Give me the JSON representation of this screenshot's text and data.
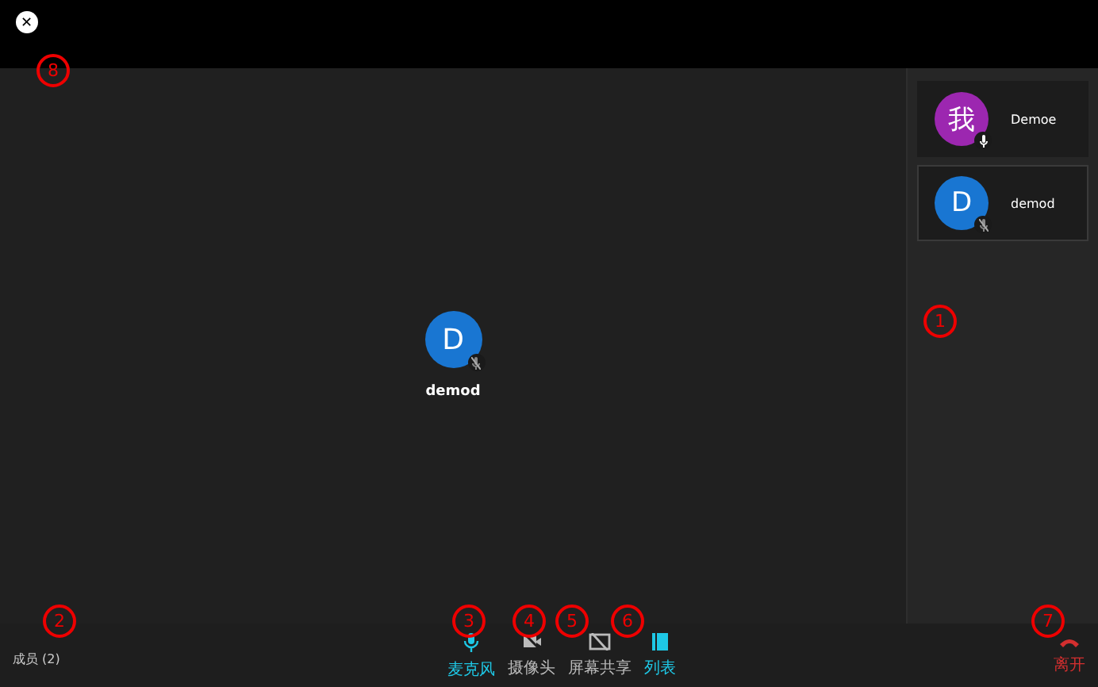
{
  "close_button": {
    "label": "✕"
  },
  "participants": [
    {
      "avatar": "我",
      "name": "Demoe",
      "color": "#9c27b0",
      "muted": false,
      "selected": false
    },
    {
      "avatar": "D",
      "name": "demod",
      "color": "#1976d2",
      "muted": true,
      "selected": true
    }
  ],
  "main_tile": {
    "avatar": "D",
    "name": "demod",
    "color": "#1976d2",
    "muted": true
  },
  "members": {
    "label": "成员 (2)"
  },
  "controls": [
    {
      "kind": "mic",
      "label": "麦克风",
      "active": true
    },
    {
      "kind": "camera",
      "label": "摄像头",
      "active": false
    },
    {
      "kind": "share",
      "label": "屏幕共享",
      "active": false
    },
    {
      "kind": "list",
      "label": "列表",
      "active": true
    }
  ],
  "leave": {
    "label": "离开"
  },
  "callouts": [
    "1",
    "2",
    "3",
    "4",
    "5",
    "6",
    "7",
    "8"
  ]
}
